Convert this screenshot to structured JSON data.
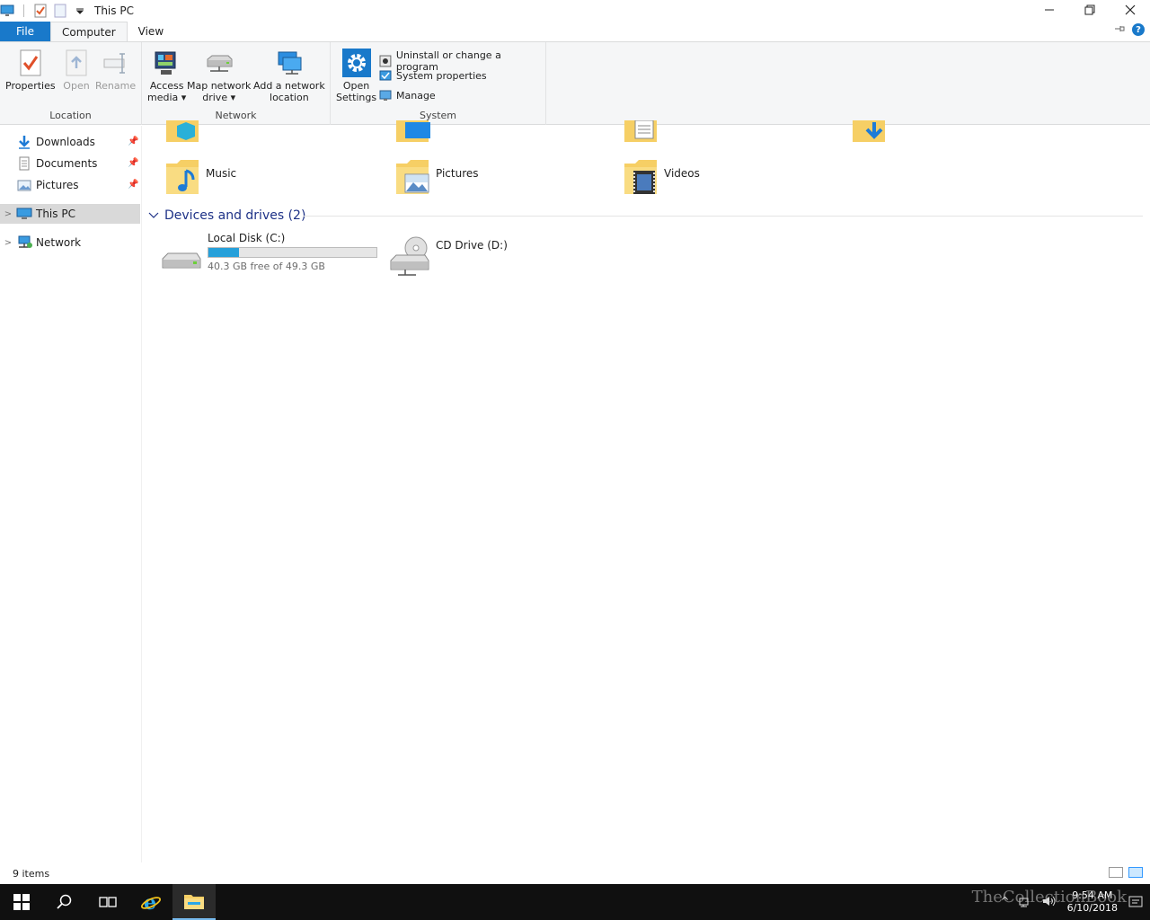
{
  "window": {
    "title": "This PC"
  },
  "tabs": [
    {
      "label": "File"
    },
    {
      "label": "Computer"
    },
    {
      "label": "View"
    }
  ],
  "ribbon": {
    "location": {
      "group_label": "Location",
      "properties": "Properties",
      "open": "Open",
      "rename": "Rename"
    },
    "network": {
      "group_label": "Network",
      "access_media_1": "Access",
      "access_media_2": "media",
      "map_drive_1": "Map network",
      "map_drive_2": "drive",
      "add_location_1": "Add a network",
      "add_location_2": "location"
    },
    "system": {
      "group_label": "System",
      "open_settings_1": "Open",
      "open_settings_2": "Settings",
      "uninstall": "Uninstall or change a program",
      "system_properties": "System properties",
      "manage": "Manage"
    }
  },
  "nav": {
    "items": [
      {
        "label": "Downloads"
      },
      {
        "label": "Documents"
      },
      {
        "label": "Pictures"
      },
      {
        "label": "This PC"
      },
      {
        "label": "Network"
      }
    ]
  },
  "folders": [
    {
      "label": "Music"
    },
    {
      "label": "Pictures"
    },
    {
      "label": "Videos"
    }
  ],
  "devices": {
    "header": "Devices and drives (2)",
    "drives": [
      {
        "label": "Local Disk (C:)",
        "free_text": "40.3 GB free of 49.3 GB",
        "used_fraction": 0.18
      },
      {
        "label": "CD Drive (D:)"
      }
    ]
  },
  "status": {
    "items": "9 items"
  },
  "taskbar": {
    "time": "9:54 AM",
    "date": "6/10/2018",
    "watermark": "TheCollectionBook"
  },
  "colors": {
    "accent": "#1979ca",
    "drive_fill": "#26a0da",
    "section_header": "#1e3287"
  }
}
